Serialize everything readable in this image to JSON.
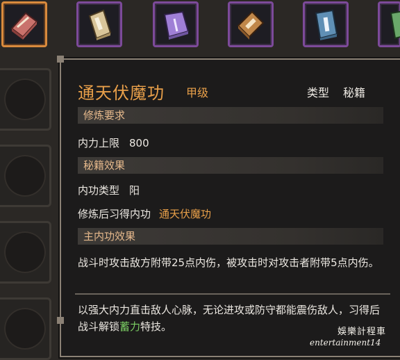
{
  "inventory": {
    "slots": [
      {
        "icon": "red-manual-icon",
        "selected": true
      },
      {
        "icon": "beige-manual-icon",
        "selected": false
      },
      {
        "icon": "purple-manual-icon",
        "selected": false
      },
      {
        "icon": "brown-manual-icon",
        "selected": false
      },
      {
        "icon": "blue-manual-icon",
        "selected": false
      },
      {
        "icon": "green-manual-icon",
        "selected": false
      }
    ]
  },
  "tooltip": {
    "title": "通天伏魔功",
    "grade": "甲级",
    "type_label": "类型",
    "type_value": "秘籍",
    "requirements_header": "修炼要求",
    "requirement_label": "内力上限",
    "requirement_value": "800",
    "effects_header": "秘籍效果",
    "inner_type_label": "内功类型",
    "inner_type_value": "阳",
    "learn_label": "修炼后习得内功",
    "learn_value": "通天伏魔功",
    "main_effect_header": "主内功效果",
    "main_effect_text": "战斗时攻击敌方附带25点内伤，被攻击时对攻击者附带5点内伤。",
    "description_pre": "以强大内力直击敌人心脉，无论进攻或防守都能震伤敌人，习得后战斗解锁",
    "description_highlight": "蓄力",
    "description_post": "特技。"
  },
  "watermark": {
    "line1": "娛樂計程車",
    "line2": "entertainment14"
  },
  "colors": {
    "title": "#e9a04a",
    "section_text": "#e6b98c",
    "highlight": "#7ccf64",
    "slot_border": "#7d4a9a",
    "selected_border": "#d98a3d"
  }
}
